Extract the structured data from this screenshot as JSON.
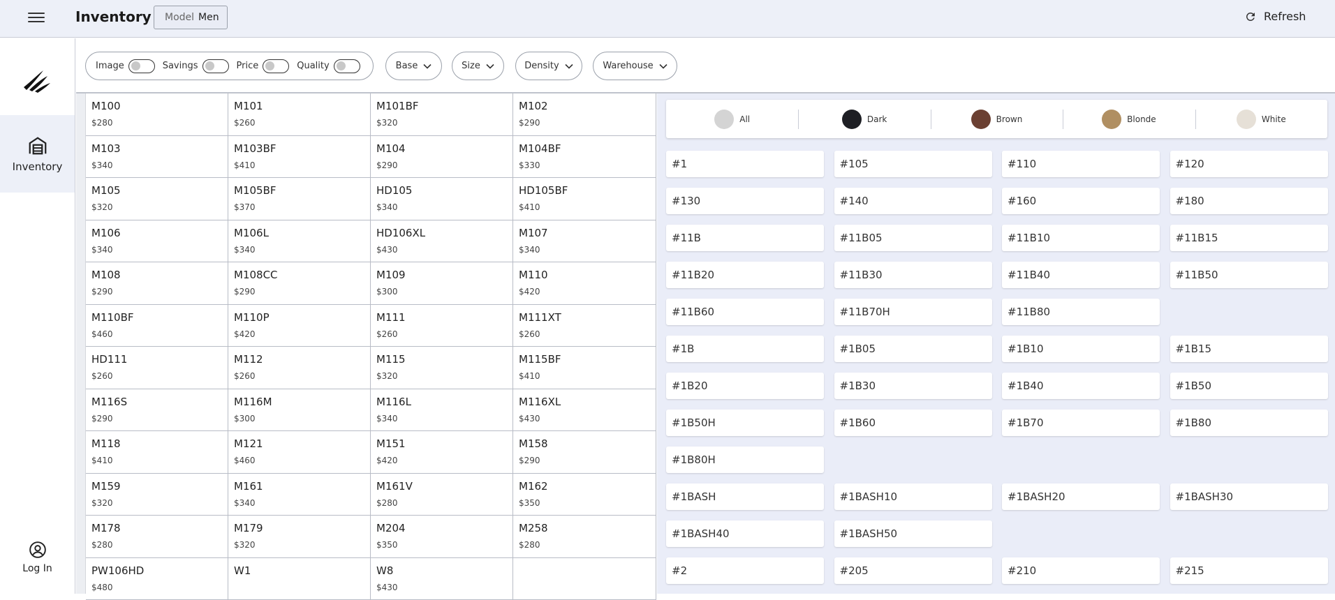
{
  "header": {
    "title": "Inventory",
    "model_label": "Model",
    "model_value": "Men",
    "refresh_label": "Refresh"
  },
  "sidebar": {
    "nav_label": "Inventory",
    "login_label": "Log In"
  },
  "filters": {
    "toggles": [
      "Image",
      "Savings",
      "Price",
      "Quality"
    ],
    "dropdowns": [
      "Base",
      "Size",
      "Density",
      "Warehouse"
    ]
  },
  "table": {
    "rows": [
      [
        {
          "code": "M100",
          "price": "$280"
        },
        {
          "code": "M101",
          "price": "$260"
        },
        {
          "code": "M101BF",
          "price": "$320"
        },
        {
          "code": "M102",
          "price": "$290"
        }
      ],
      [
        {
          "code": "M103",
          "price": "$340"
        },
        {
          "code": "M103BF",
          "price": "$410"
        },
        {
          "code": "M104",
          "price": "$290"
        },
        {
          "code": "M104BF",
          "price": "$330"
        }
      ],
      [
        {
          "code": "M105",
          "price": "$320"
        },
        {
          "code": "M105BF",
          "price": "$370"
        },
        {
          "code": "HD105",
          "price": "$340"
        },
        {
          "code": "HD105BF",
          "price": "$410"
        }
      ],
      [
        {
          "code": "M106",
          "price": "$340"
        },
        {
          "code": "M106L",
          "price": "$340"
        },
        {
          "code": "HD106XL",
          "price": "$430"
        },
        {
          "code": "M107",
          "price": "$340"
        }
      ],
      [
        {
          "code": "M108",
          "price": "$290"
        },
        {
          "code": "M108CC",
          "price": "$290"
        },
        {
          "code": "M109",
          "price": "$300"
        },
        {
          "code": "M110",
          "price": "$420"
        }
      ],
      [
        {
          "code": "M110BF",
          "price": "$460"
        },
        {
          "code": "M110P",
          "price": "$420"
        },
        {
          "code": "M111",
          "price": "$260"
        },
        {
          "code": "M111XT",
          "price": "$260"
        }
      ],
      [
        {
          "code": "HD111",
          "price": "$260"
        },
        {
          "code": "M112",
          "price": "$260"
        },
        {
          "code": "M115",
          "price": "$320"
        },
        {
          "code": "M115BF",
          "price": "$410"
        }
      ],
      [
        {
          "code": "M116S",
          "price": "$290"
        },
        {
          "code": "M116M",
          "price": "$300"
        },
        {
          "code": "M116L",
          "price": "$340"
        },
        {
          "code": "M116XL",
          "price": "$430"
        }
      ],
      [
        {
          "code": "M118",
          "price": "$410"
        },
        {
          "code": "M121",
          "price": "$460"
        },
        {
          "code": "M151",
          "price": "$420"
        },
        {
          "code": "M158",
          "price": "$290"
        }
      ],
      [
        {
          "code": "M159",
          "price": "$320"
        },
        {
          "code": "M161",
          "price": "$340"
        },
        {
          "code": "M161V",
          "price": "$280"
        },
        {
          "code": "M162",
          "price": "$350"
        }
      ],
      [
        {
          "code": "M178",
          "price": "$280"
        },
        {
          "code": "M179",
          "price": "$320"
        },
        {
          "code": "M204",
          "price": "$350"
        },
        {
          "code": "M258",
          "price": "$280"
        }
      ],
      [
        {
          "code": "PW106HD",
          "price": "$480"
        },
        {
          "code": "W1",
          "price": ""
        },
        {
          "code": "W8",
          "price": "$430"
        },
        {
          "code": "",
          "price": ""
        }
      ]
    ]
  },
  "swatches": [
    {
      "label": "All",
      "color": "#d4d4d4"
    },
    {
      "label": "Dark",
      "color": "#1e1f24"
    },
    {
      "label": "Brown",
      "color": "#6b4032"
    },
    {
      "label": "Blonde",
      "color": "#b08f62"
    },
    {
      "label": "White",
      "color": "#e6e0d7"
    }
  ],
  "color_codes": [
    "#1",
    "#105",
    "#110",
    "#120",
    "#130",
    "#140",
    "#160",
    "#180",
    "#11B",
    "#11B05",
    "#11B10",
    "#11B15",
    "#11B20",
    "#11B30",
    "#11B40",
    "#11B50",
    "#11B60",
    "#11B70H",
    "#11B80",
    "",
    "#1B",
    "#1B05",
    "#1B10",
    "#1B15",
    "#1B20",
    "#1B30",
    "#1B40",
    "#1B50",
    "#1B50H",
    "#1B60",
    "#1B70",
    "#1B80",
    "#1B80H",
    "",
    "",
    "",
    "#1BASH",
    "#1BASH10",
    "#1BASH20",
    "#1BASH30",
    "#1BASH40",
    "#1BASH50",
    "",
    "",
    "#2",
    "#205",
    "#210",
    "#215"
  ]
}
